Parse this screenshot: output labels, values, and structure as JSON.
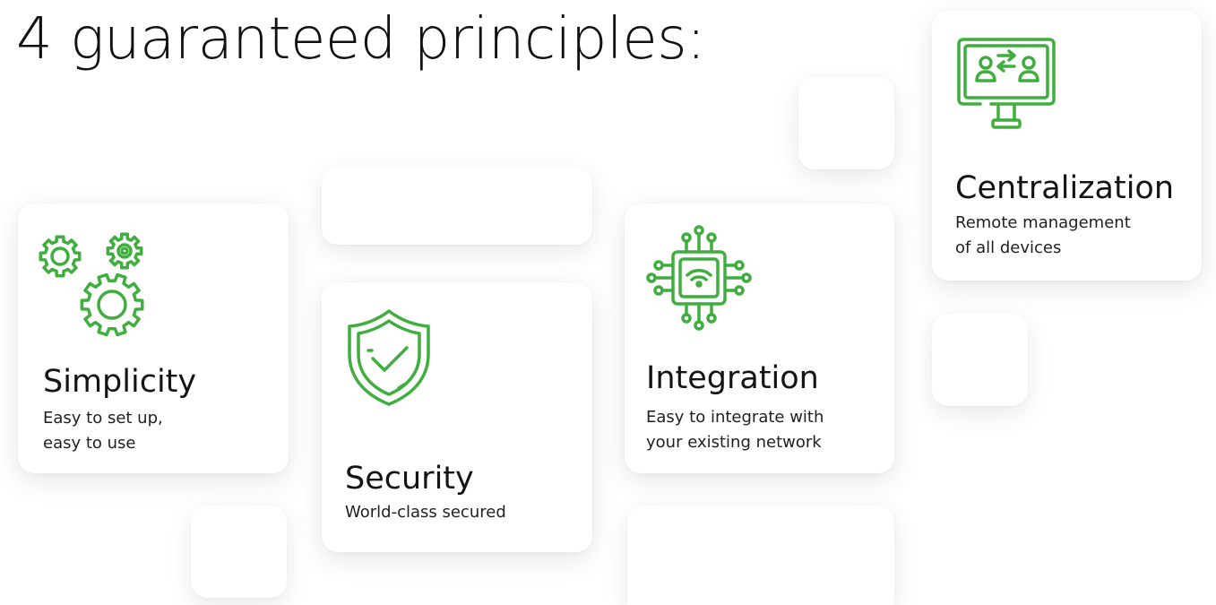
{
  "heading": "4 guaranteed principles:",
  "accent_color": "#3fae3f",
  "cards": {
    "simplicity": {
      "icon": "gears-icon",
      "title": "Simplicity",
      "desc_line1": "Easy to set up,",
      "desc_line2": "easy to use"
    },
    "security": {
      "icon": "shield-check-icon",
      "title": "Security",
      "desc_line1": "World-class secured"
    },
    "integration": {
      "icon": "chip-wifi-icon",
      "title": "Integration",
      "desc_line1": "Easy to integrate with",
      "desc_line2": "your existing network"
    },
    "centralization": {
      "icon": "remote-monitor-icon",
      "title": "Centralization",
      "desc_line1": "Remote management",
      "desc_line2": "of all devices"
    }
  }
}
